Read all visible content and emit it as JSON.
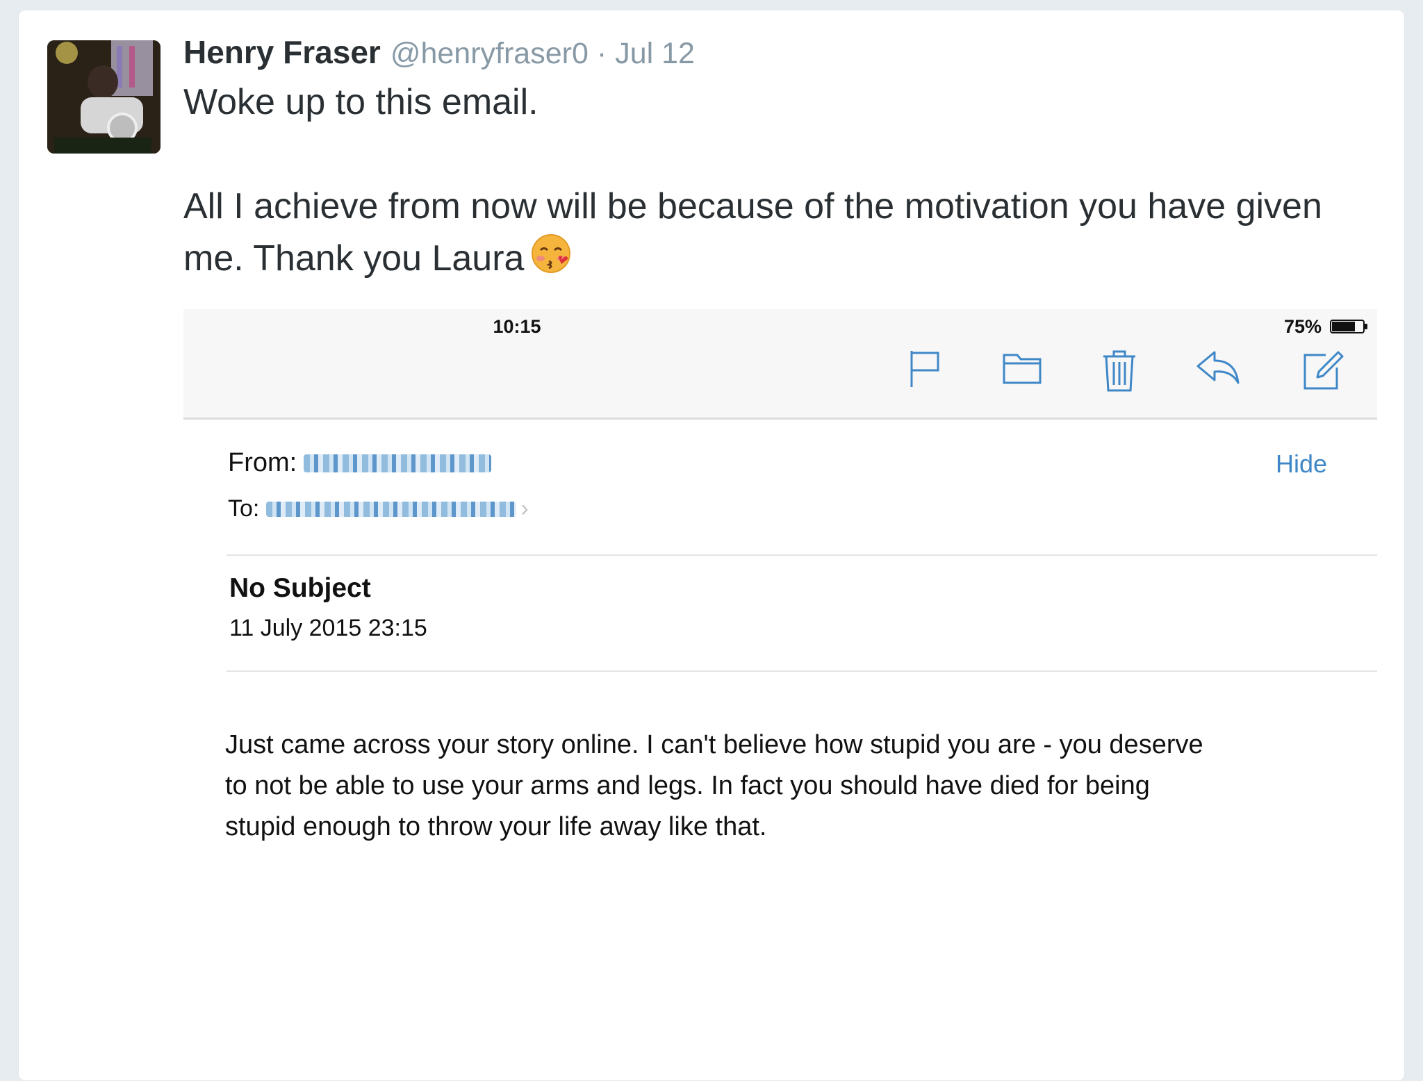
{
  "tweet": {
    "display_name": "Henry Fraser",
    "screen_name": "@henryfraser0",
    "separator": "·",
    "date": "Jul 12",
    "text_line1": "Woke up to this email.",
    "text_line2a": "All I achieve from now will be because of the motivation you have given",
    "text_line2b": "me. Thank you Laura",
    "emoji": "face-throwing-kiss"
  },
  "email_screenshot": {
    "status_bar": {
      "time": "10:15",
      "battery": "75%",
      "battery_level": 0.75
    },
    "toolbar_icons": [
      "flag-icon",
      "folder-icon",
      "trash-icon",
      "reply-icon",
      "compose-icon"
    ],
    "header": {
      "from_label": "From:",
      "to_label": "To:",
      "hide_label": "Hide",
      "subject": "No Subject",
      "date": "11 July 2015 23:15"
    },
    "body_lines": [
      "Just came across your story online.  I can't believe how stupid you are - you deserve",
      "to not be able to use your arms and legs.  In fact you should have died for being",
      "stupid enough to throw your life away like that."
    ]
  },
  "colors": {
    "page_bg": "#e6ecf0",
    "name": "#292f33",
    "muted": "#8899a6",
    "ios_blue": "#3f87c7"
  }
}
